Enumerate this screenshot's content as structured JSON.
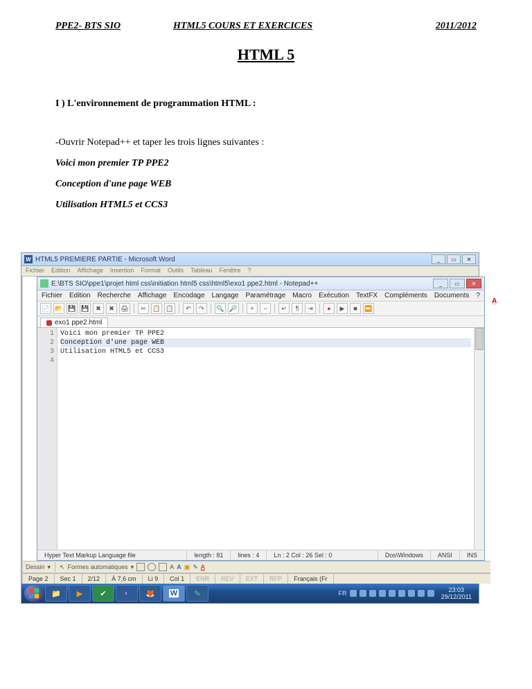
{
  "header": {
    "left": "PPE2- BTS SIO",
    "center": "HTML5 COURS ET EXERCICES",
    "right": "2011/2012"
  },
  "title": "HTML 5",
  "section1": "I ) L'environnement de programmation HTML :",
  "line_open": "-Ouvrir Notepad++ et taper les trois lignes suivantes :",
  "bi1": "Voici mon premier TP PPE2",
  "bi2": "Conception d'une page WEB",
  "bi3": "Utilisation HTML5 et CCS3",
  "word": {
    "title": "HTML5 PREMIERE PARTIE - Microsoft Word",
    "menu": [
      "Fichier",
      "Edition",
      "Affichage",
      "Insertion",
      "Format",
      "Outils",
      "Tableau",
      "Fenêtre",
      "?"
    ],
    "draw_label": "Dessin",
    "formes_label": "Formes automatiques",
    "status": {
      "page": "Page  2",
      "sec": "Sec  1",
      "pages": "2/12",
      "at": "À  7,6 cm",
      "li": "Li  9",
      "col": "Col  1",
      "enr": "ENR",
      "rev": "REV",
      "ext": "EXT",
      "rfp": "RFP",
      "lang": "Français (Fr"
    }
  },
  "npp": {
    "title": "E:\\BTS SIO\\ppe1\\projet html css\\initiation html5 css\\html5\\exo1 ppe2.html - Notepad++",
    "menu": [
      "Fichier",
      "Edition",
      "Recherche",
      "Affichage",
      "Encodage",
      "Langage",
      "Paramétrage",
      "Macro",
      "Exécution",
      "TextFX",
      "Compléments",
      "Documents",
      "?"
    ],
    "tab": "exo1 ppe2.html",
    "code": {
      "l1": "Voici mon premier TP PPE2",
      "l2": "Conception d'une page WEB",
      "l3": "Utilisation HTML5 et CCS3"
    },
    "linenums": [
      "1",
      "2",
      "3",
      "4"
    ],
    "status": {
      "type": "Hyper Text Markup Language file",
      "length": "length : 81",
      "lines": "lines : 4",
      "pos": "Ln : 2   Col : 26   Sel : 0",
      "eol": "Dos\\Windows",
      "enc": "ANSI",
      "ins": "INS"
    }
  },
  "taskbar": {
    "lang": "FR",
    "time": "23:03",
    "date": "29/12/2011"
  }
}
